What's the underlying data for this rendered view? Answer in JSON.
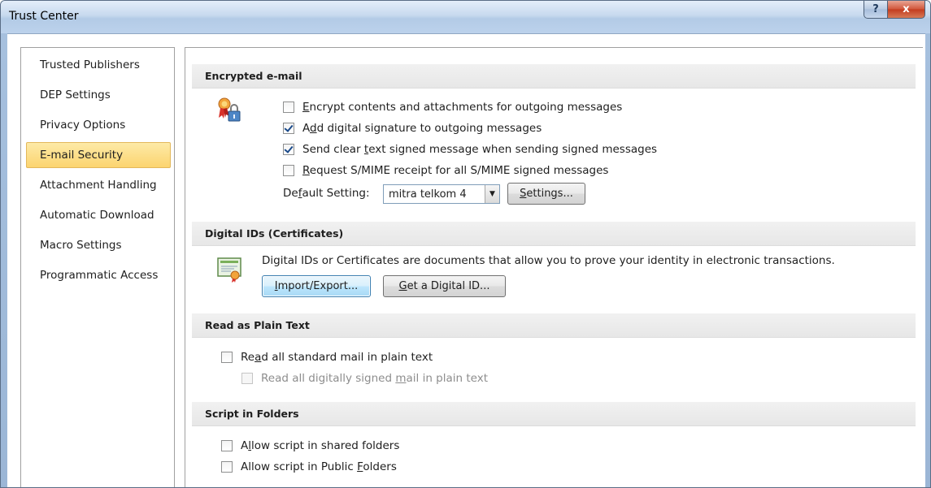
{
  "window": {
    "title": "Trust Center",
    "help_label": "?",
    "close_label": "x"
  },
  "sidebar": {
    "items": [
      {
        "label": "Trusted Publishers"
      },
      {
        "label": "DEP Settings"
      },
      {
        "label": "Privacy Options"
      },
      {
        "label": "E-mail Security",
        "selected": true
      },
      {
        "label": "Attachment Handling"
      },
      {
        "label": "Automatic Download"
      },
      {
        "label": "Macro Settings"
      },
      {
        "label": "Programmatic Access"
      }
    ]
  },
  "encrypted_email": {
    "header": "Encrypted e-mail",
    "icon": "certificate-lock-icon",
    "options": [
      {
        "pre": "",
        "key": "E",
        "post": "ncrypt contents and attachments for outgoing messages",
        "checked": false
      },
      {
        "pre": "A",
        "key": "d",
        "post": "d digital signature to outgoing messages",
        "checked": true
      },
      {
        "pre": "Send clear ",
        "key": "t",
        "post": "ext signed message when sending signed messages",
        "checked": true
      },
      {
        "pre": "",
        "key": "R",
        "post": "equest S/MIME receipt for all S/MIME signed messages",
        "checked": false
      }
    ],
    "default_setting": {
      "pre": "De",
      "key": "f",
      "post": "ault Setting:"
    },
    "default_value": "mitra telkom 4",
    "settings_button": {
      "pre": "",
      "key": "S",
      "post": "ettings..."
    }
  },
  "digital_ids": {
    "header": "Digital IDs (Certificates)",
    "icon": "certificate-icon",
    "description": "Digital IDs or Certificates are documents that allow you to prove your identity in electronic transactions.",
    "import_button": {
      "pre": "",
      "key": "I",
      "post": "mport/Export..."
    },
    "get_id_button": {
      "pre": "",
      "key": "G",
      "post": "et a Digital ID..."
    }
  },
  "plain_text": {
    "header": "Read as Plain Text",
    "read_all": {
      "pre": "Re",
      "key": "a",
      "post": "d all standard mail in plain text",
      "checked": false
    },
    "read_signed": {
      "pre": "Read all digitally signed ",
      "key": "m",
      "post": "ail in plain text",
      "checked": false,
      "disabled": true
    }
  },
  "script_folders": {
    "header": "Script in Folders",
    "shared": {
      "pre": "A",
      "key": "l",
      "post": "low script in shared folders",
      "checked": false
    },
    "public": {
      "pre": "Allow script in Public ",
      "key": "F",
      "post": "olders",
      "checked": false
    }
  },
  "colors": {
    "selected_bg": "#fcd46f",
    "selected_border": "#e3b85b",
    "close_red": "#c23b1e"
  }
}
